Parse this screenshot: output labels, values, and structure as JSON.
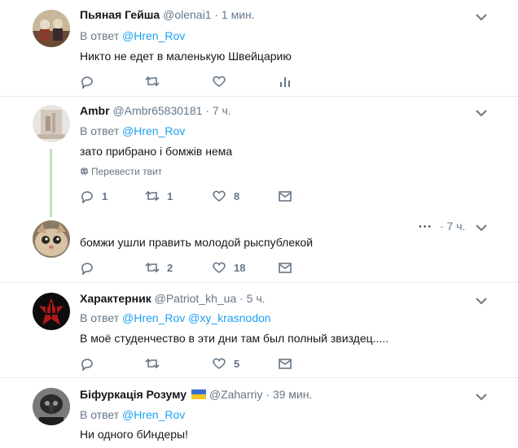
{
  "tweets": [
    {
      "name": "Пьяная Гейша",
      "handle": "@olenai1",
      "time": "· 1 мин.",
      "reply_prefix": "В ответ",
      "reply_to": "@Hren_Rov",
      "text": "Никто не едет в маленькую Швейцарию",
      "replies": "",
      "retweets": "",
      "likes": ""
    },
    {
      "name": "Ambr",
      "handle": "@Ambr65830181",
      "time": "· 7 ч.",
      "reply_prefix": "В ответ",
      "reply_to": "@Hren_Rov",
      "text": "зато прибрано і бомжів нема",
      "translate": "Перевести твит",
      "replies": "1",
      "retweets": "1",
      "likes": "8"
    },
    {
      "dots": "···",
      "time": "· 7 ч.",
      "text": "бомжи ушли править молодой рыспублекой",
      "replies": "",
      "retweets": "2",
      "likes": "18"
    },
    {
      "name": "Характерник",
      "handle": "@Patriot_kh_ua",
      "time": "· 5 ч.",
      "reply_prefix": "В ответ",
      "reply_to": "@Hren_Rov",
      "reply_to_2": "@xy_krasnodon",
      "text": "В моё студенчество в эти дни там был полный звиздец.....",
      "replies": "",
      "retweets": "",
      "likes": "5"
    },
    {
      "name": "Біфуркація Розуму",
      "flag": "🇺🇦",
      "handle": "@Zaharriy",
      "time": "· 39 мин.",
      "reply_prefix": "В ответ",
      "reply_to": "@Hren_Rov",
      "text": "Ни одного бИндеры!"
    }
  ],
  "icons": {
    "reply": "reply-icon",
    "retweet": "retweet-icon",
    "like": "heart-icon",
    "analytics": "analytics-icon",
    "dm": "envelope-icon",
    "menu": "chevron-down-icon",
    "translate": "globe-icon"
  },
  "colors": {
    "link": "#1da1f2",
    "muted": "#657786",
    "thread": "#c5e0c5"
  }
}
